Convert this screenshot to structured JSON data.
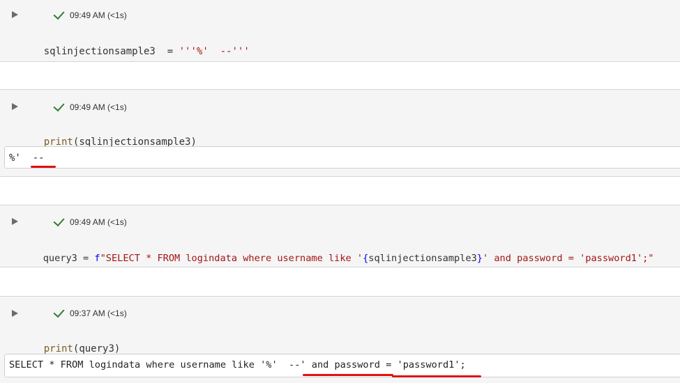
{
  "cells": [
    {
      "status_time": "09:49 AM (<1s)",
      "code": {
        "var": "sqlinjectionsample3",
        "eq": "=",
        "str": "'''%'  --'''"
      }
    },
    {
      "status_time": "09:49 AM (<1s)",
      "code": {
        "fn": "print",
        "open": "(",
        "arg": "sqlinjectionsample3",
        "close": ")"
      },
      "output": "%'  --"
    },
    {
      "status_time": "09:49 AM (<1s)",
      "code": {
        "var": "query3",
        "eq": " = ",
        "prefix": "f",
        "str_a": "\"SELECT * FROM logindata where username like '",
        "brace_open": "{",
        "interp": "sqlinjectionsample3",
        "brace_close": "}",
        "str_b": "' and password = 'password1';\""
      }
    },
    {
      "status_time": "09:37 AM (<1s)",
      "code": {
        "fn": "print",
        "open": "(",
        "arg": "query3",
        "close": ")"
      },
      "output": "SELECT * FROM logindata where username like '%'  --' and password = 'password1';"
    }
  ],
  "colors": {
    "annotation": "#e01010",
    "check": "#2e7d32",
    "string": "#a31515",
    "brace": "#0000ff",
    "cell_bg": "#f5f5f5"
  }
}
